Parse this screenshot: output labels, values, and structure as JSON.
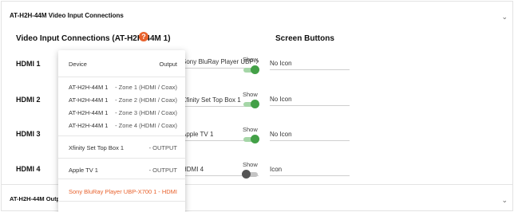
{
  "section_top": {
    "title": "AT-H2H-44M Video Input Connections"
  },
  "panel": {
    "title": "Video Input Connections (AT-H2H-44M 1)",
    "help_icon": "?",
    "screen_buttons_heading": "Screen Buttons"
  },
  "rows": [
    {
      "label": "HDMI 1",
      "name": "Sony BluRay Player UBP-X700 1",
      "show": "Show",
      "toggle_on": true,
      "icon": "No Icon"
    },
    {
      "label": "HDMI 2",
      "name": "Xfinity Set Top Box 1",
      "show": "Show",
      "toggle_on": true,
      "icon": "No Icon"
    },
    {
      "label": "HDMI 3",
      "name": "Apple TV 1",
      "show": "Show",
      "toggle_on": true,
      "icon": "No Icon"
    },
    {
      "label": "HDMI 4",
      "name": "HDMI 4",
      "show": "Show",
      "toggle_on": false,
      "icon": "Icon"
    }
  ],
  "section_bottom": {
    "title": "AT-H2H-44M Outpu"
  },
  "dropdown": {
    "header_left": "Device",
    "header_right": "Output",
    "items": [
      {
        "device": "AT-H2H-44M 1",
        "output": "- Zone 1 (HDMI / Coax)"
      },
      {
        "device": "AT-H2H-44M 1",
        "output": "- Zone 2 (HDMI / Coax)"
      },
      {
        "device": "AT-H2H-44M 1",
        "output": "- Zone 3 (HDMI / Coax)"
      },
      {
        "device": "AT-H2H-44M 1",
        "output": "- Zone 4 (HDMI / Coax)"
      },
      {
        "device": "Xfinity Set Top Box 1",
        "output": "- OUTPUT"
      },
      {
        "device": "Apple TV 1",
        "output": "- OUTPUT"
      },
      {
        "device": "Sony BluRay Player UBP-X700 1",
        "output": "- HDMI"
      }
    ]
  },
  "colors": {
    "accent": "#e8622d",
    "toggle_on": "#43a047",
    "toggle_off": "#555555"
  },
  "icons": {
    "chevron": "chevron-down-icon",
    "help": "help-icon"
  }
}
